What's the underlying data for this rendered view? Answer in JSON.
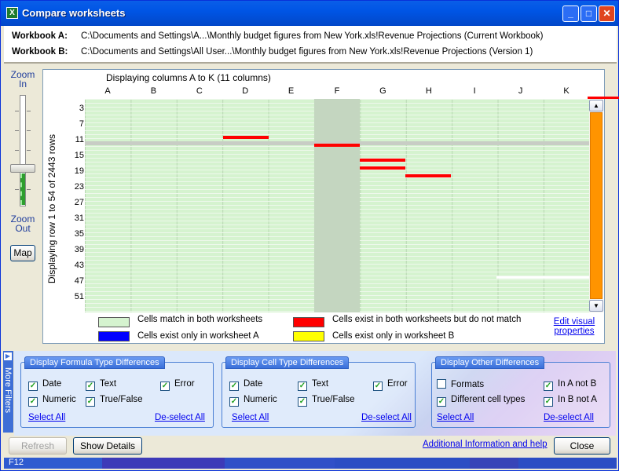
{
  "window": {
    "title": "Compare worksheets",
    "icon": "excel-icon"
  },
  "workbooks": {
    "a_label": "Workbook A:",
    "a_path": "C:\\Documents and Settings\\A...\\Monthly budget figures from New York.xls!Revenue Projections (Current Workbook)",
    "b_label": "Workbook B:",
    "b_path": "C:\\Documents and Settings\\All User...\\Monthly budget figures from New York.xls!Revenue Projections (Version 1)"
  },
  "zoom": {
    "in_line1": "Zoom",
    "in_line2": "In",
    "out_line1": "Zoom",
    "out_line2": "Out",
    "map_label": "Map"
  },
  "grid": {
    "title": "Displaying columns A to K (11 columns)",
    "row_label": "Displaying row 1 to 54 of 2443 rows",
    "columns": [
      "A",
      "B",
      "C",
      "D",
      "E",
      "F",
      "G",
      "H",
      "I",
      "J",
      "K"
    ],
    "rows": [
      "3",
      "7",
      "11",
      "15",
      "19",
      "23",
      "27",
      "31",
      "35",
      "39",
      "43",
      "47",
      "51"
    ]
  },
  "legend": {
    "match": "Cells match in both worksheets",
    "only_a": "Cells exist only in worksheet A",
    "differ": "Cells exist in both worksheets but do not match",
    "only_b": "Cells exist only in worksheet B",
    "edit_line1": "Edit visual",
    "edit_line2": "properties",
    "colors": {
      "match": "#d5f3cf",
      "only_a": "#0000ff",
      "differ": "#ff0000",
      "only_b": "#ffff00"
    }
  },
  "more_filters": "More Filters",
  "groups": {
    "formula": {
      "title": "Display Formula Type Differences",
      "items": [
        {
          "label": "Date",
          "checked": true
        },
        {
          "label": "Text",
          "checked": true
        },
        {
          "label": "Error",
          "checked": true
        },
        {
          "label": "Numeric",
          "checked": true
        },
        {
          "label": "True/False",
          "checked": true
        }
      ],
      "select_all": "Select All",
      "deselect_all": "De-select All"
    },
    "celltype": {
      "title": "Display Cell Type Differences",
      "items": [
        {
          "label": "Date",
          "checked": true
        },
        {
          "label": "Text",
          "checked": true
        },
        {
          "label": "Error",
          "checked": true
        },
        {
          "label": "Numeric",
          "checked": true
        },
        {
          "label": "True/False",
          "checked": true
        }
      ],
      "select_all": "Select All",
      "deselect_all": "De-select All"
    },
    "other": {
      "title": "Display Other Differences",
      "items": [
        {
          "label": "Formats",
          "checked": false
        },
        {
          "label": "In A not B",
          "checked": true
        },
        {
          "label": "Different cell types",
          "checked": true
        },
        {
          "label": "In B not A",
          "checked": true
        }
      ],
      "select_all": "Select All",
      "deselect_all": "De-select All"
    }
  },
  "buttons": {
    "refresh": "Refresh",
    "show_details": "Show Details",
    "close": "Close",
    "help_link": "Additional Information and help"
  },
  "status": {
    "text": "F12"
  }
}
